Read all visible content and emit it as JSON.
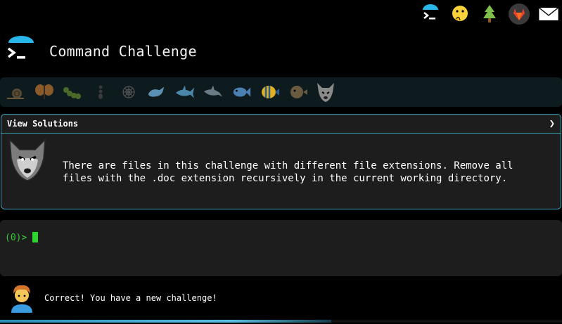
{
  "header": {
    "title": "Command Challenge"
  },
  "top_icons": [
    "terminal-icon",
    "shushing-face-icon",
    "tree-icon",
    "gitlab-icon",
    "mail-icon"
  ],
  "animals": [
    "snail-icon",
    "butterfly-icon",
    "caterpillar-icon",
    "ant-icon",
    "spider-web-icon",
    "whale-icon",
    "shark-icon",
    "dolphin-icon",
    "fish-icon",
    "tropical-fish-icon",
    "blowfish-icon",
    "wolf-icon"
  ],
  "challenge": {
    "view_solutions": "View Solutions",
    "description": "There are files in this challenge with different file extensions. Remove all\nfiles with the .doc extension recursively in the current working directory."
  },
  "terminal": {
    "prompt": "(0)>"
  },
  "status": {
    "message": "Correct! You have a new challenge!"
  },
  "progress": {
    "fraction": 0.59
  },
  "colors": {
    "accent": "#3aa0b8",
    "prompt": "#37c837",
    "panel": "#1d1d1d"
  }
}
